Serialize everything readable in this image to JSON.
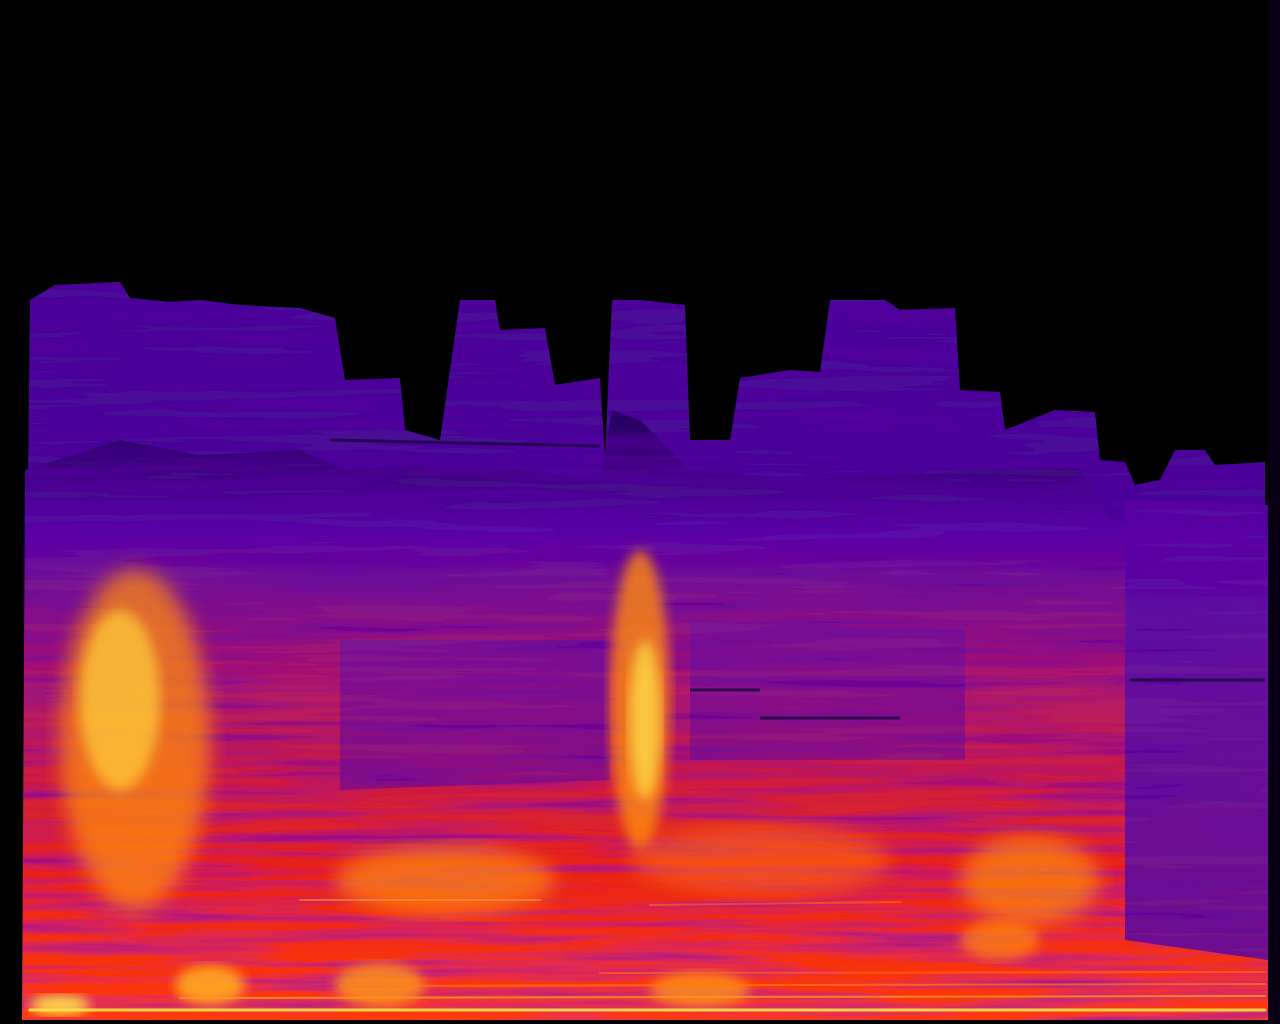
{
  "image": {
    "kind": "audio-spectrogram",
    "colormap": "inferno",
    "palette": {
      "background": "#000000",
      "low": "#24005e",
      "mid_low": "#5a0fa8",
      "mid": "#b01a6a",
      "mid_high": "#e8231a",
      "high": "#ff8a10",
      "peak": "#ffe24a"
    }
  }
}
